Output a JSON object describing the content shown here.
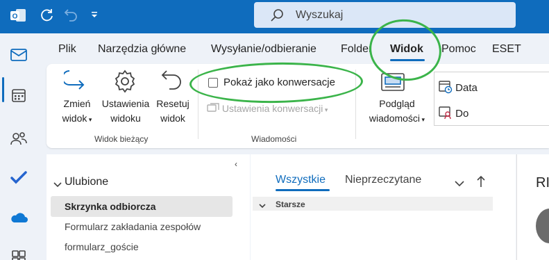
{
  "search": {
    "placeholder": "Wyszukaj"
  },
  "tabs": [
    {
      "label": "Plik"
    },
    {
      "label": "Narzędzia główne"
    },
    {
      "label": "Wysyłanie/odbieranie"
    },
    {
      "label": "Folder"
    },
    {
      "label": "Widok",
      "active": true
    },
    {
      "label": "Pomoc"
    },
    {
      "label": "ESET"
    }
  ],
  "ribbon": {
    "change_view": {
      "line1": "Zmień",
      "line2": "widok"
    },
    "view_settings": {
      "line1": "Ustawienia",
      "line2": "widoku"
    },
    "reset_view": {
      "line1": "Resetuj",
      "line2": "widok"
    },
    "group_current_view": "Widok bieżący",
    "show_as_conversations": "Pokaż jako konwersacje",
    "conversation_settings": "Ustawienia konwersacji",
    "group_messages": "Wiadomości",
    "message_preview": {
      "line1": "Podgląd",
      "line2": "wiadomości"
    },
    "sort_date": "Data",
    "sort_to": "Do"
  },
  "folders": {
    "favorites_header": "Ulubione",
    "items": [
      "Skrzynka odbiorcza",
      "Formularz zakładania zespołów",
      "formularz_goście"
    ],
    "selected_index": 0
  },
  "message_list": {
    "tabs": [
      "Wszystkie",
      "Nieprzeczytane"
    ],
    "active_tab": 0,
    "group_header": "Starsze"
  },
  "reading_pane": {
    "header_fragment": "RI"
  },
  "colors": {
    "brand": "#0f6cbd",
    "annotation": "#3bb44a"
  }
}
